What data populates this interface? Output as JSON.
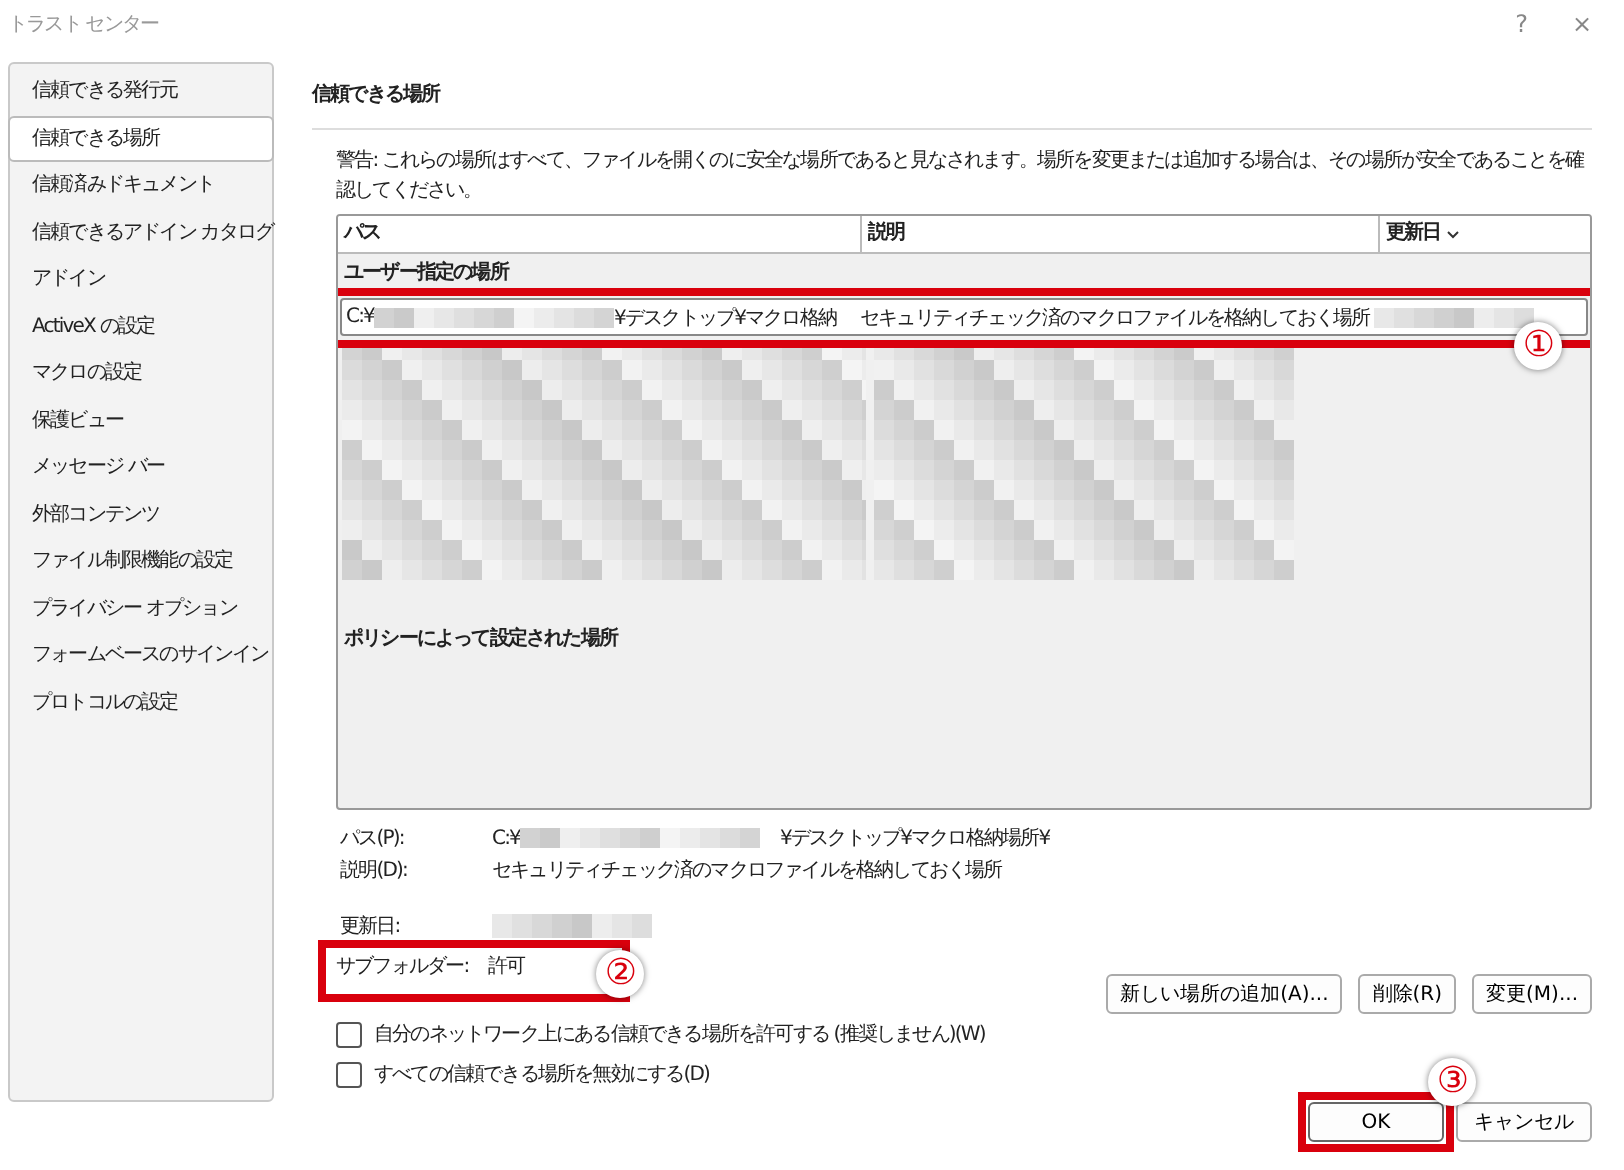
{
  "window": {
    "title": "トラスト センター",
    "help": "?",
    "close": "×"
  },
  "sidebar": {
    "items": [
      {
        "label": "信頼できる発行元",
        "selected": false
      },
      {
        "label": "信頼できる場所",
        "selected": true
      },
      {
        "label": "信頼済みドキュメント",
        "selected": false
      },
      {
        "label": "信頼できるアドイン カタログ",
        "selected": false
      },
      {
        "label": "アドイン",
        "selected": false
      },
      {
        "label": "ActiveX の設定",
        "selected": false
      },
      {
        "label": "マクロの設定",
        "selected": false
      },
      {
        "label": "保護ビュー",
        "selected": false
      },
      {
        "label": "メッセージ バー",
        "selected": false
      },
      {
        "label": "外部コンテンツ",
        "selected": false
      },
      {
        "label": "ファイル制限機能の設定",
        "selected": false
      },
      {
        "label": "プライバシー オプション",
        "selected": false
      },
      {
        "label": "フォームベースのサインイン",
        "selected": false
      },
      {
        "label": "プロトコルの設定",
        "selected": false
      }
    ]
  },
  "section_title": "信頼できる場所",
  "warning": "警告: これらの場所はすべて、ファイルを開くのに安全な場所であると見なされます。場所を変更または追加する場合は、その場所が安全であることを確認してください。",
  "table": {
    "columns": [
      "パス",
      "説明",
      "更新日"
    ],
    "groups": [
      {
        "label": "ユーザー指定の場所",
        "rows": [
          {
            "path_start": "C:¥",
            "path_end": "¥デスクトップ¥マクロ格納",
            "description": "セキュリティチェック済のマクロファイルを格納しておく場所",
            "selected": true
          }
        ]
      },
      {
        "label": "ポリシーによって設定された場所"
      }
    ]
  },
  "details": [
    {
      "label": "パス(P):",
      "value_start": "C:¥",
      "value_end": "¥デスクトップ¥マクロ格納場所¥"
    },
    {
      "label": "説明(D):",
      "value": "セキュリティチェック済のマクロファイルを格納しておく場所"
    },
    {
      "label": "更新日:"
    },
    {
      "label": "サブフォルダー:",
      "value": "許可"
    }
  ],
  "buttons": [
    "新しい場所の追加(A)...",
    "削除(R)",
    "変更(M)..."
  ],
  "checkboxes": [
    {
      "label": "自分のネットワーク上にある信頼できる場所を許可する (推奨しません)(W)",
      "checked": false
    },
    {
      "label": "すべての信頼できる場所を無効にする(D)",
      "checked": false
    }
  ],
  "footer_buttons": [
    "OK",
    "キャンセル"
  ],
  "annotations": [
    {
      "label": "①"
    },
    {
      "label": "②"
    },
    {
      "label": "③"
    }
  ]
}
